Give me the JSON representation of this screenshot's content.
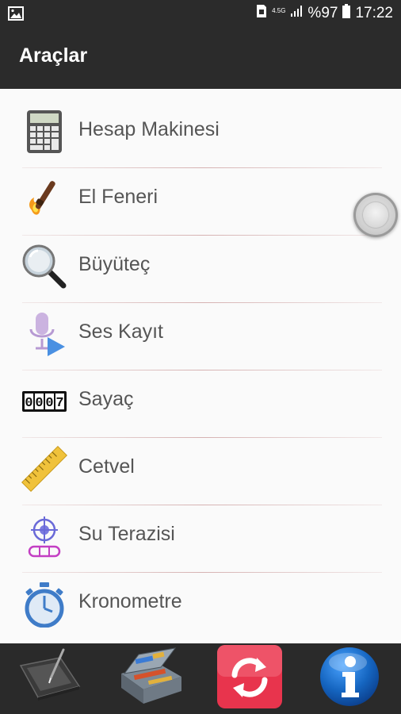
{
  "status_bar": {
    "network_type": "4.5G",
    "battery_percent": "%97",
    "time": "17:22"
  },
  "app_bar": {
    "title": "Araçlar"
  },
  "tools": [
    {
      "label": "Hesap Makinesi",
      "icon": "calculator-icon"
    },
    {
      "label": "El Feneri",
      "icon": "flashlight-torch-icon"
    },
    {
      "label": "Büyüteç",
      "icon": "magnifier-icon"
    },
    {
      "label": "Ses Kayıt",
      "icon": "microphone-record-icon"
    },
    {
      "label": "Sayaç",
      "icon": "counter-icon",
      "counter_digits": [
        "0",
        "0",
        "0",
        "7"
      ]
    },
    {
      "label": "Cetvel",
      "icon": "ruler-icon"
    },
    {
      "label": "Su Terazisi",
      "icon": "spirit-level-icon"
    },
    {
      "label": "Kronometre",
      "icon": "stopwatch-icon"
    }
  ],
  "bottom_bar": [
    {
      "icon": "drawing-tablet-icon"
    },
    {
      "icon": "toolbox-icon"
    },
    {
      "icon": "refresh-icon",
      "accent": "#e8344d"
    },
    {
      "icon": "info-icon",
      "accent": "#1565c0"
    }
  ]
}
